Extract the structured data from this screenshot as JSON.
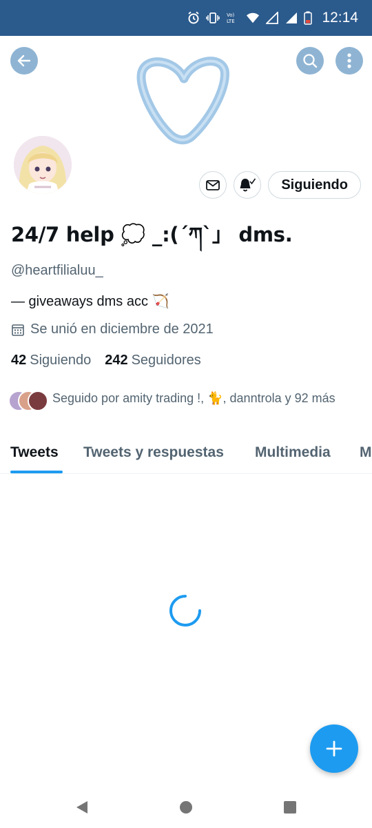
{
  "status_bar": {
    "time": "12:14",
    "network_label": "Vo) LTE",
    "icons": [
      "alarm-icon",
      "vibrate-icon",
      "volte-icon",
      "wifi-icon",
      "signal-icon",
      "signal-icon",
      "battery-icon"
    ]
  },
  "header": {
    "back_icon": "arrow-left-icon",
    "search_icon": "search-icon",
    "more_icon": "more-vertical-icon",
    "banner_icon": "heart-outline-icon"
  },
  "actions": {
    "message_icon": "mail-icon",
    "notify_icon": "bell-check-icon",
    "follow_label": "Siguiendo"
  },
  "profile": {
    "name": "24/7 help 💭 _:(´ཀ`」 dms.",
    "handle": "@heartfilialuu_",
    "bio": "— giveaways dms acc 🏹",
    "joined": "Se unió en diciembre de 2021",
    "following_count": "42",
    "following_label": "Siguiendo",
    "followers_count": "242",
    "followers_label": "Seguidores"
  },
  "followed_by": {
    "text": "Seguido por amity trading !, 🐈, danntrola y 92 más"
  },
  "tabs": [
    {
      "label": "Tweets",
      "active": true
    },
    {
      "label": "Tweets y respuestas",
      "active": false
    },
    {
      "label": "Multimedia",
      "active": false
    },
    {
      "label": "M",
      "active": false
    }
  ],
  "fab": {
    "icon": "plus-icon"
  },
  "colors": {
    "accent": "#1d9bf0",
    "status_bar": "#2b5a8c",
    "header_buttons": "#8fb4d3",
    "secondary_text": "#536471"
  }
}
